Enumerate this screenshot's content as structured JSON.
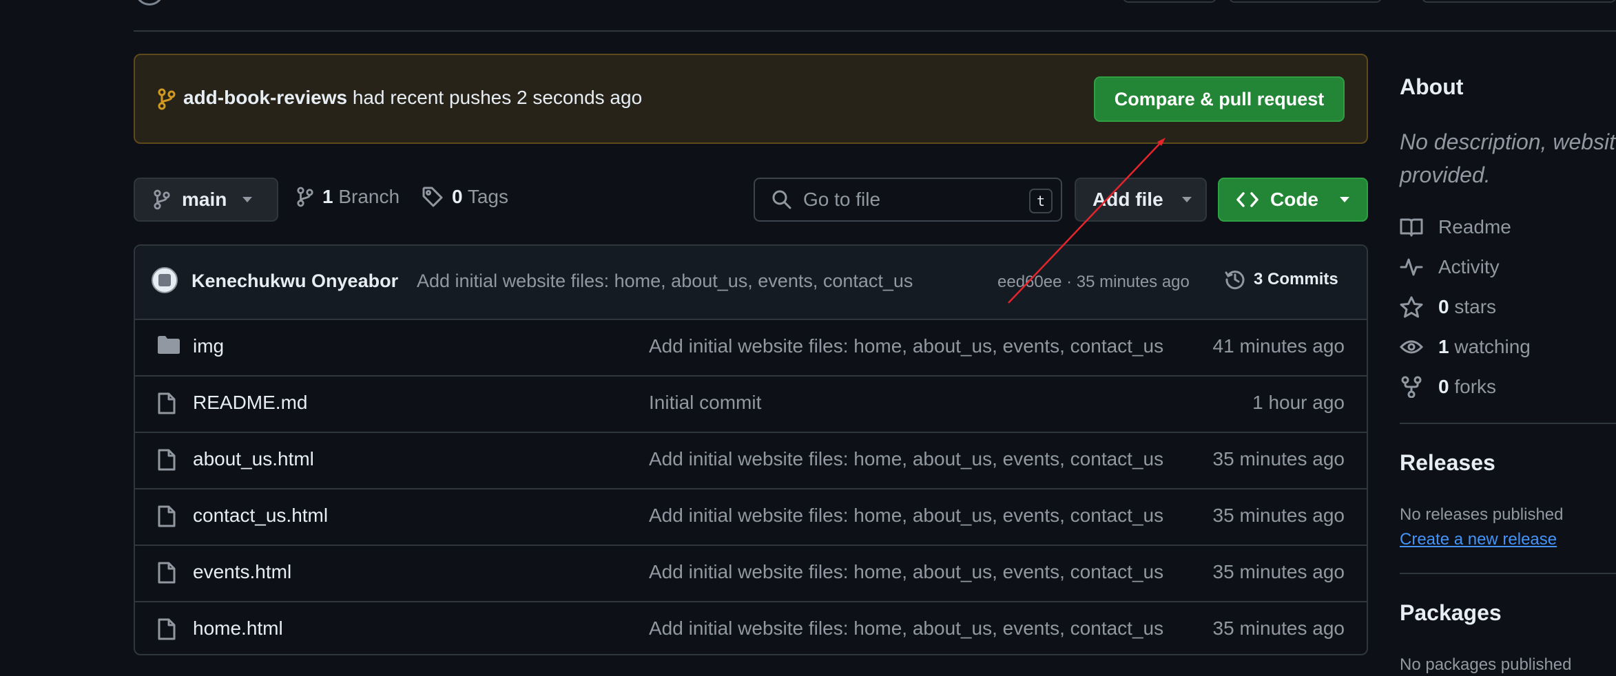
{
  "banner": {
    "branch": "add-book-reviews",
    "message": " had recent pushes 2 seconds ago",
    "button_label": "Compare & pull request"
  },
  "toolbar": {
    "branch_select": "main",
    "branches_count": "1",
    "branches_label": "Branch",
    "tags_count": "0",
    "tags_label": "Tags",
    "search_placeholder": "Go to file",
    "search_shortcut": "t",
    "add_file_label": "Add file",
    "code_label": "Code"
  },
  "latest_commit": {
    "author": "Kenechukwu Onyeabor",
    "message": "Add initial website files: home, about_us, events, contact_us",
    "meta": "eed60ee · 35 minutes ago",
    "commits_label": "3 Commits"
  },
  "files": [
    {
      "name": "img",
      "type": "folder",
      "message": "Add initial website files: home, about_us, events, contact_us",
      "time": "41 minutes ago"
    },
    {
      "name": "README.md",
      "type": "file",
      "message": "Initial commit",
      "time": "1 hour ago"
    },
    {
      "name": "about_us.html",
      "type": "file",
      "message": "Add initial website files: home, about_us, events, contact_us",
      "time": "35 minutes ago"
    },
    {
      "name": "contact_us.html",
      "type": "file",
      "message": "Add initial website files: home, about_us, events, contact_us",
      "time": "35 minutes ago"
    },
    {
      "name": "events.html",
      "type": "file",
      "message": "Add initial website files: home, about_us, events, contact_us",
      "time": "35 minutes ago"
    },
    {
      "name": "home.html",
      "type": "file",
      "message": "Add initial website files: home, about_us, events, contact_us",
      "time": "35 minutes ago"
    }
  ],
  "sidebar": {
    "about_heading": "About",
    "about_description": "No description, website, or topics provided.",
    "readme_label": "Readme",
    "activity_label": "Activity",
    "stars_count": "0",
    "stars_label": "stars",
    "watching_count": "1",
    "watching_label": "watching",
    "forks_count": "0",
    "forks_label": "forks",
    "releases_heading": "Releases",
    "releases_text": "No releases published",
    "releases_link": "Create a new release",
    "packages_heading": "Packages",
    "packages_text": "No packages published"
  },
  "icons": {
    "branch": "git-branch-icon",
    "tag": "tag-icon",
    "search": "search-icon",
    "code": "code-icon",
    "history": "history-icon",
    "folder": "folder-icon",
    "file": "file-icon",
    "book": "book-icon",
    "pulse": "pulse-icon",
    "star": "star-icon",
    "eye": "eye-icon",
    "fork": "repo-forked-icon"
  },
  "colors": {
    "background": "#0d1117",
    "banner_background": "#282319",
    "banner_border": "#5e4a1a",
    "primary_button": "#238636",
    "link": "#4493f8",
    "muted_text": "#9198a1",
    "annotation_arrow": "#e5252b"
  }
}
